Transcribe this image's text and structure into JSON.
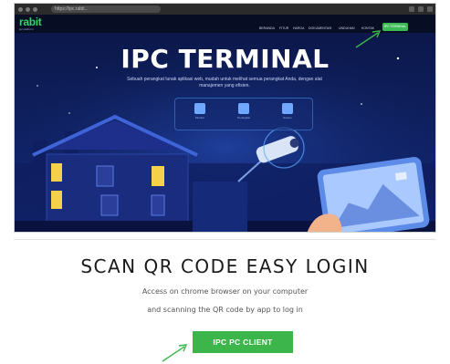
{
  "browser": {
    "address": "https://ipc.rabit...",
    "buttons": [
      "back",
      "forward",
      "reload"
    ]
  },
  "site": {
    "logo": "rabit",
    "logo_tagline": "ipc platform",
    "nav_items": [
      "BERANDA",
      "FITUR",
      "HARGA",
      "DOKUMENTASI",
      "UNDUHAN",
      "KONTAK"
    ],
    "nav_button": "IPC TERMINAL",
    "accent": "#3cba54",
    "hero_bg": "#0a1440"
  },
  "hero": {
    "title": "IPC TERMINAL",
    "subtitle": "Sebuah perangkat lunak aplikasi web, mudah untuk melihat semua perangkat Anda, dengan alat manajemen yang efisien.",
    "features": [
      {
        "icon": "monitor-icon",
        "label": "Monitor"
      },
      {
        "icon": "device-icon",
        "label": "Perangkat"
      },
      {
        "icon": "record-icon",
        "label": "Rekam"
      }
    ]
  },
  "panel": {
    "title": "SCAN QR CODE EASY LOGIN",
    "line1": "Access on chrome browser on your computer",
    "line2": "and scanning the QR code by app to log in",
    "button": "IPC PC CLIENT",
    "button_color": "#3cb54a"
  }
}
